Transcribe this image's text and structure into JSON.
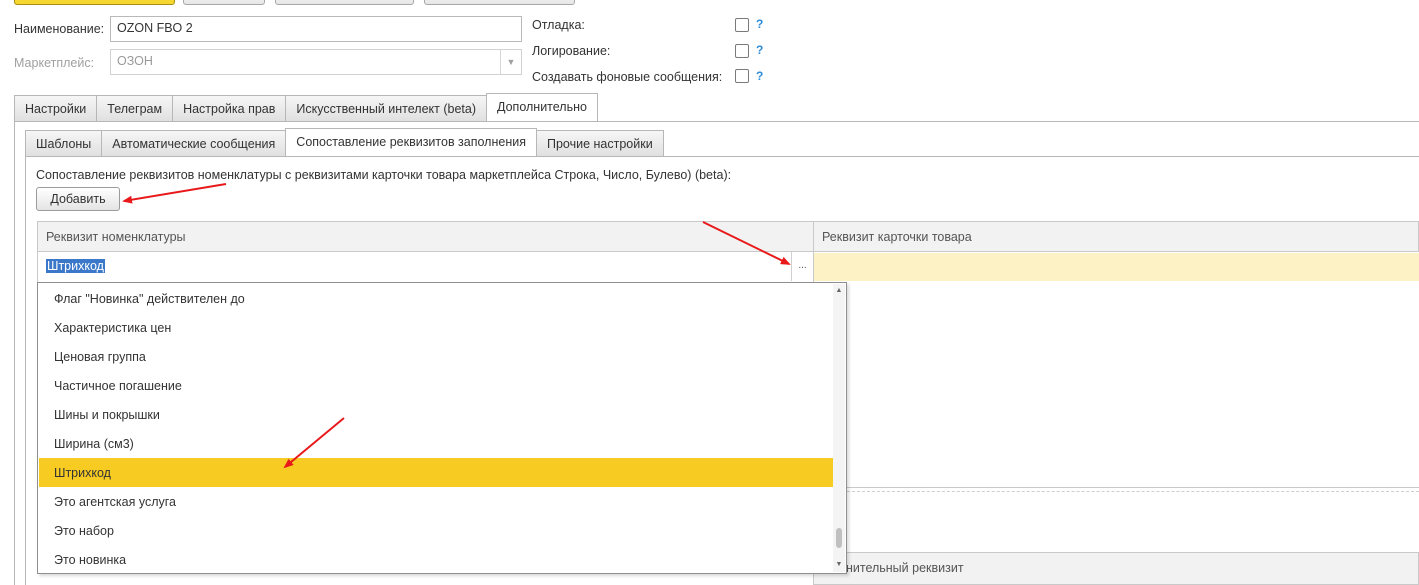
{
  "form": {
    "name_label": "Наименование:",
    "name_value": "OZON FBO 2",
    "marketplace_label": "Маркетплейс:",
    "marketplace_value": "ОЗОН",
    "debug_label": "Отладка:",
    "logging_label": "Логирование:",
    "background_label": "Создавать фоновые сообщения:",
    "help_mark": "?"
  },
  "tabs": [
    "Настройки",
    "Телеграм",
    "Настройка прав",
    "Искусственный интелект (beta)",
    "Дополнительно"
  ],
  "subtabs": [
    "Шаблоны",
    "Автоматические сообщения",
    "Сопоставление реквизитов заполнения",
    "Прочие настройки"
  ],
  "section": {
    "description": "Сопоставление реквизитов номенклатуры с реквизитами карточки товара маркетплейса Строка, Число, Булево) (beta):",
    "add_button": "Добавить"
  },
  "grid": {
    "col1": "Реквизит номенклатуры",
    "col2": "Реквизит карточки товара",
    "row_value": "Штрихкод",
    "ellipsis": "...",
    "bottom_col2_partial": "олнительный реквизит"
  },
  "dropdown": {
    "items": [
      "Флаг \"Новинка\" действителен до",
      "Характеристика цен",
      "Ценовая группа",
      "Частичное погашение",
      "Шины и покрышки",
      "Ширина (см3)",
      "Штрихкод",
      "Это агентская услуга",
      "Это набор",
      "Это новинка"
    ],
    "selected": "Штрихкод"
  },
  "colors": {
    "accent_yellow": "#f8cb22",
    "row_highlight": "#fdf2c6",
    "arrow_red": "#e8191b",
    "help_blue": "#2e8bd6"
  }
}
